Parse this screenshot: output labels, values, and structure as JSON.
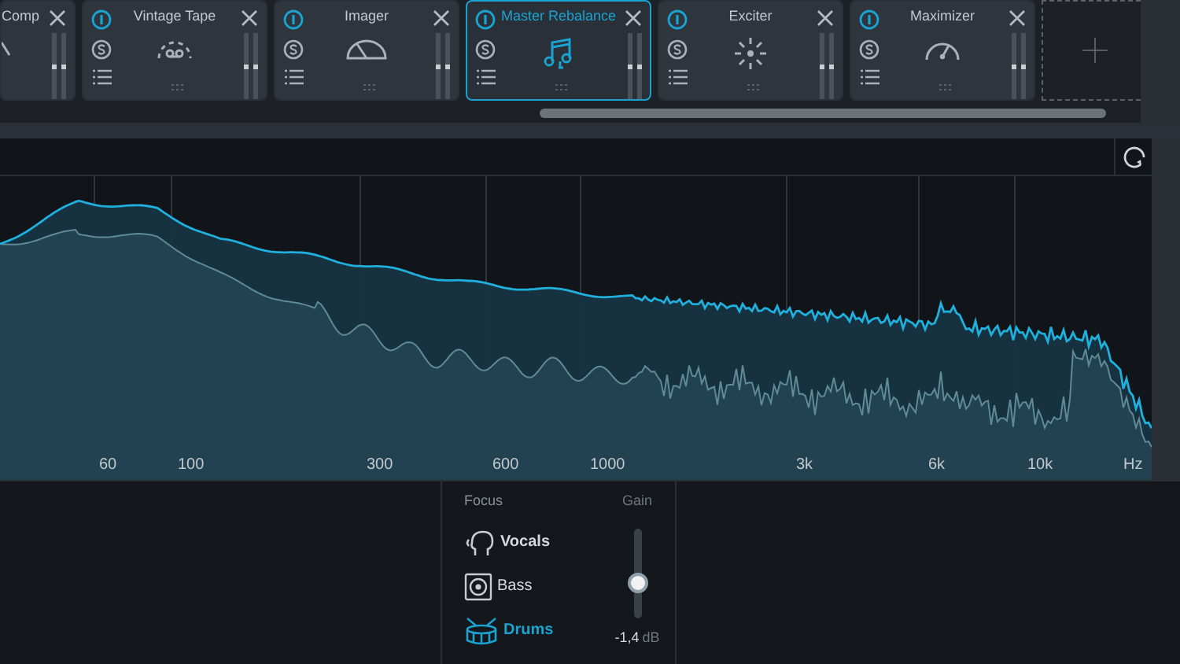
{
  "modules": [
    {
      "name": "Comp",
      "kind": "comp",
      "selected": false
    },
    {
      "name": "Vintage Tape",
      "kind": "tape",
      "selected": false
    },
    {
      "name": "Imager",
      "kind": "imager",
      "selected": false
    },
    {
      "name": "Master Rebalance",
      "kind": "rebalance",
      "selected": true
    },
    {
      "name": "Exciter",
      "kind": "exciter",
      "selected": false
    },
    {
      "name": "Maximizer",
      "kind": "maximizer",
      "selected": false
    }
  ],
  "spectrum": {
    "freq_labels": [
      "60",
      "100",
      "300",
      "600",
      "1000",
      "3k",
      "6k",
      "10k",
      "Hz"
    ]
  },
  "focus": {
    "title": "Focus",
    "items": [
      {
        "label": "Vocals",
        "kind": "vocals",
        "selected": false
      },
      {
        "label": "Bass",
        "kind": "bass",
        "selected": false
      },
      {
        "label": "Drums",
        "kind": "drums",
        "selected": true
      }
    ]
  },
  "gain": {
    "title": "Gain",
    "level": 0.37,
    "value": "-1,4",
    "unit": "dB"
  }
}
